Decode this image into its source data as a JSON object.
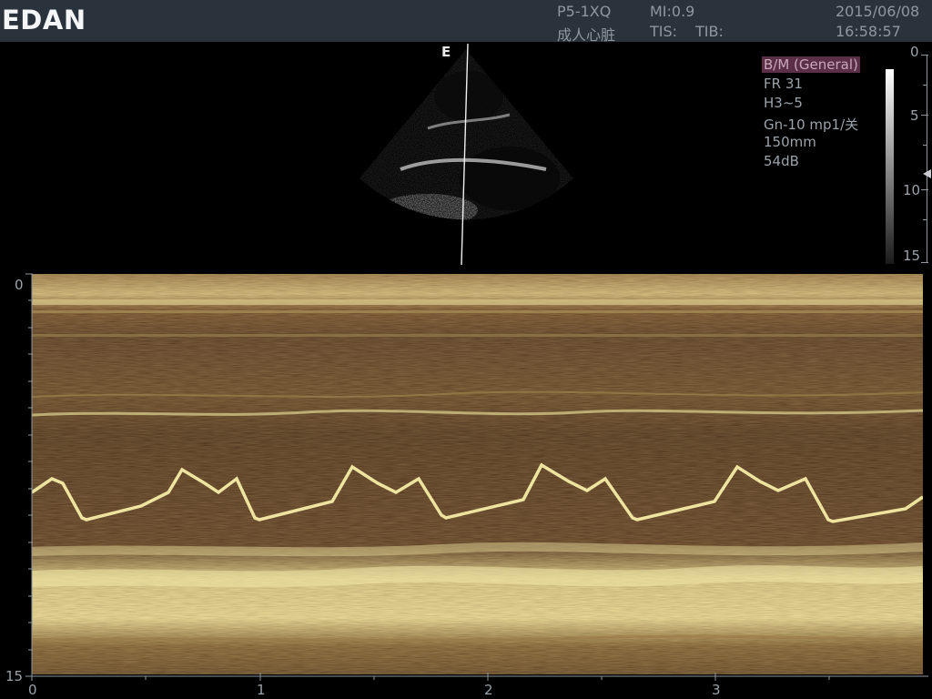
{
  "brand": "EDAN",
  "header": {
    "probe": "P5-1XQ",
    "preset": "成人心脏",
    "mi": "MI:0.9",
    "tis": "TIS:",
    "tib": "TIB:",
    "date": "2015/06/08",
    "time": "16:58:57"
  },
  "bmode": {
    "orientation_marker": "E",
    "params": [
      "B/M (General)",
      "FR 31",
      "H3~5",
      "Gn-10 mp1/关",
      "150mm",
      "54dB"
    ],
    "depth_scale": [
      "0",
      "5",
      "10",
      "15"
    ]
  },
  "mmode": {
    "depth_labels": [
      "0",
      "15"
    ],
    "time_labels": [
      "0",
      "1",
      "2",
      "3"
    ]
  },
  "colors": {
    "topbar": "#2a323b",
    "param_highlight": "#5b2f45",
    "mmode_dark": "#3a1c10",
    "mmode_bright": "#e8dc9a"
  }
}
